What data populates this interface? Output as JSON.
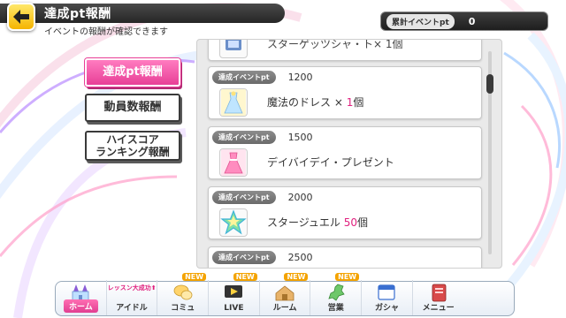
{
  "header": {
    "title": "達成pt報酬",
    "subtitle": "イベントの報酬が確認できます"
  },
  "points": {
    "label": "累計イベントpt",
    "value": "0"
  },
  "tabs": [
    {
      "label_lines": [
        "達成pt報酬"
      ],
      "active": true
    },
    {
      "label_lines": [
        "動員数報酬"
      ],
      "active": false
    },
    {
      "label_lines": [
        "ハイスコア",
        "ランキング報酬"
      ],
      "active": false
    }
  ],
  "rewards": [
    {
      "pt_label": "",
      "pt": "",
      "name": "スターゲッツシャ・ト× 1個",
      "qty": "",
      "icon": "partial-item-icon"
    },
    {
      "pt_label": "達成イベントpt",
      "pt": "1200",
      "name": "魔法のドレス × ",
      "qty": "1",
      "suffix": "個",
      "icon": "magic-dress-icon"
    },
    {
      "pt_label": "達成イベントpt",
      "pt": "1500",
      "name": "デイバイデイ・プレゼント",
      "qty": "",
      "suffix": "",
      "icon": "pink-dress-icon"
    },
    {
      "pt_label": "達成イベントpt",
      "pt": "2000",
      "name": "スタージュエル ",
      "qty": "50",
      "suffix": "個",
      "icon": "star-jewel-icon"
    },
    {
      "pt_label": "達成イベントpt",
      "pt": "2500",
      "name": "",
      "qty": "",
      "suffix": "",
      "icon": ""
    }
  ],
  "nav": {
    "lesson_banner": "レッスン大成功⬆",
    "items": [
      {
        "label": "ホーム",
        "icon": "castle-icon",
        "new": false
      },
      {
        "label": "アイドル",
        "icon": "idol-icon",
        "new": false
      },
      {
        "label": "コミュ",
        "icon": "commu-icon",
        "new": true
      },
      {
        "label": "LIVE",
        "icon": "live-icon",
        "new": true
      },
      {
        "label": "ルーム",
        "icon": "room-icon",
        "new": true
      },
      {
        "label": "営業",
        "icon": "map-icon",
        "new": true
      },
      {
        "label": "ガシャ",
        "icon": "gacha-icon",
        "new": false
      },
      {
        "label": "メニュー",
        "icon": "menu-book-icon",
        "new": false
      }
    ],
    "new_label": "NEW"
  },
  "colors": {
    "accent_pink": "#e83f97",
    "back_button": "#f5b400",
    "header_dark": "#262626"
  }
}
